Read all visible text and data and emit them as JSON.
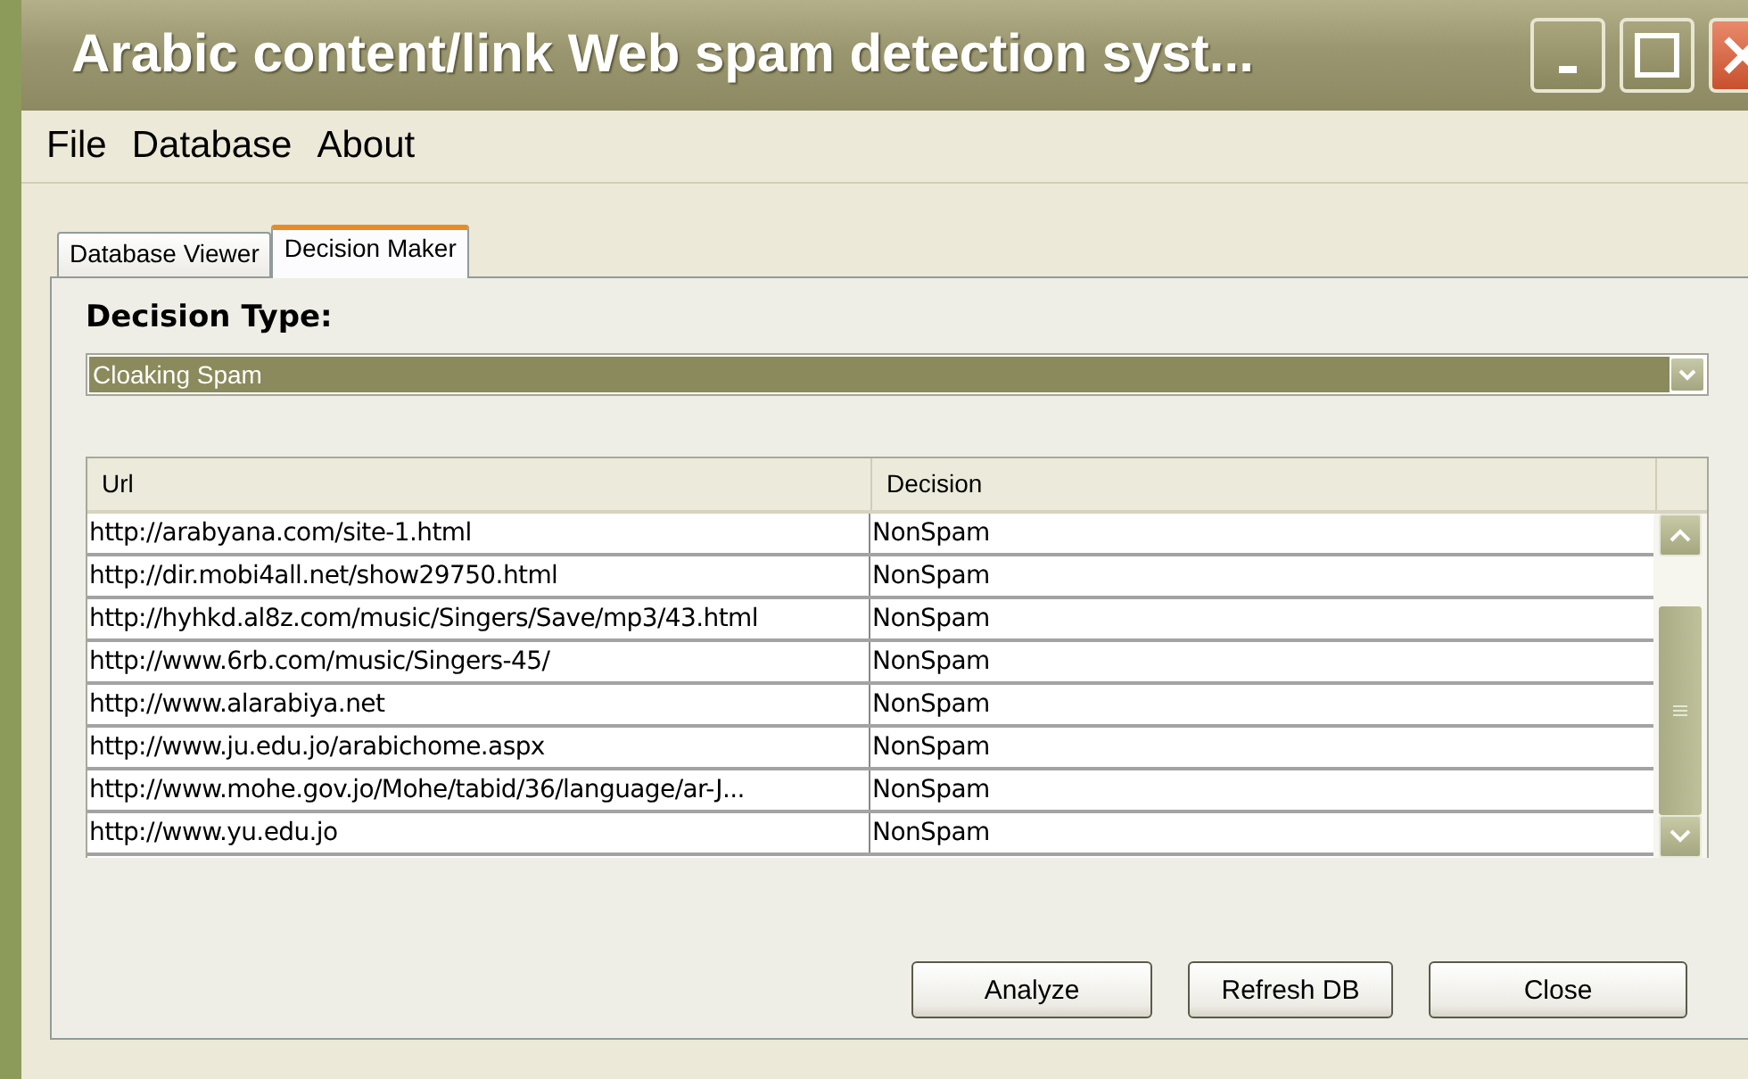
{
  "window": {
    "title": "Arabic content/link Web spam detection syst..."
  },
  "menu": [
    "File",
    "Database",
    "About"
  ],
  "tabs": [
    {
      "label": "Database Viewer",
      "selected": false
    },
    {
      "label": "Decision Maker",
      "selected": true
    }
  ],
  "decision_type": {
    "label": "Decision Type:",
    "value": "Cloaking Spam"
  },
  "table": {
    "columns": [
      "Url",
      "Decision"
    ],
    "rows": [
      [
        "http://arabyana.com/site-1.html",
        "NonSpam"
      ],
      [
        "http://dir.mobi4all.net/show29750.html",
        "NonSpam"
      ],
      [
        "http://hyhkd.al8z.com/music/Singers/Save/mp3/43.html",
        "NonSpam"
      ],
      [
        "http://www.6rb.com/music/Singers-45/",
        "NonSpam"
      ],
      [
        "http://www.alarabiya.net",
        "NonSpam"
      ],
      [
        "http://www.ju.edu.jo/arabichome.aspx",
        "NonSpam"
      ],
      [
        "http://www.mohe.gov.jo/Mohe/tabid/36/language/ar-J...",
        "NonSpam"
      ],
      [
        "http://www.yu.edu.jo",
        "NonSpam"
      ]
    ]
  },
  "buttons": [
    "Analyze",
    "Refresh DB",
    "Close"
  ]
}
